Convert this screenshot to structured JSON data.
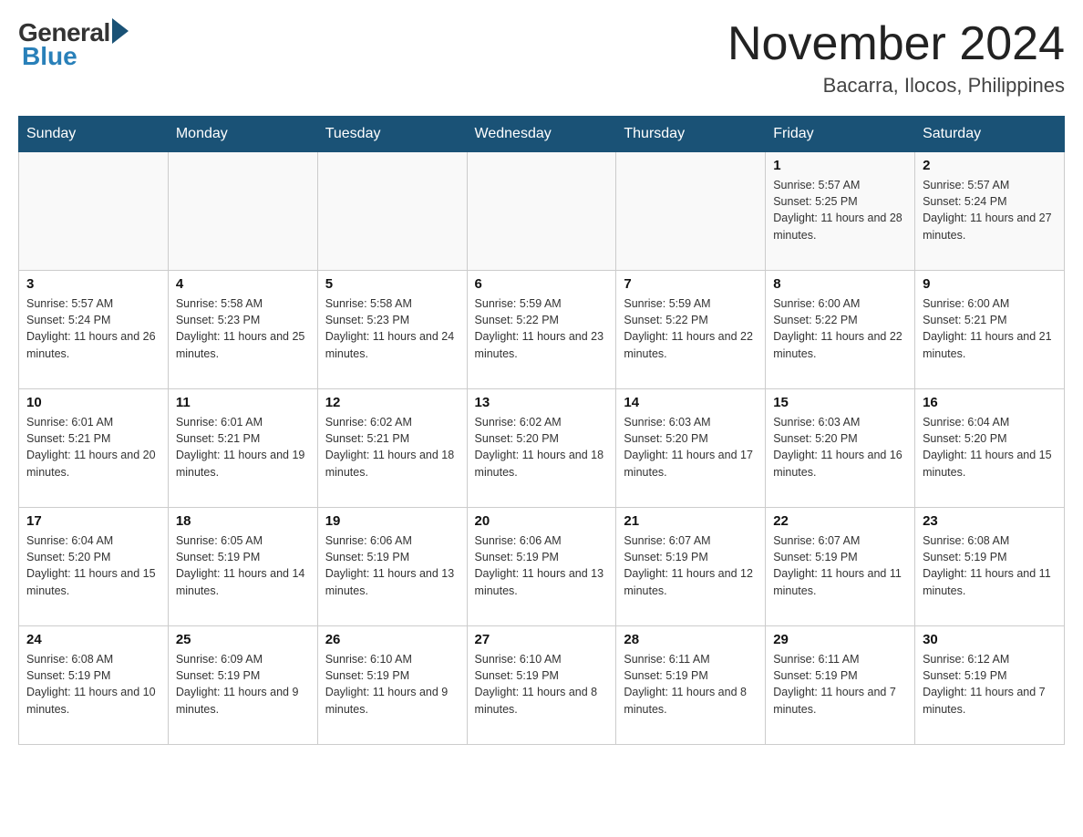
{
  "logo": {
    "general": "General",
    "blue": "Blue"
  },
  "title": "November 2024",
  "subtitle": "Bacarra, Ilocos, Philippines",
  "weekdays": [
    "Sunday",
    "Monday",
    "Tuesday",
    "Wednesday",
    "Thursday",
    "Friday",
    "Saturday"
  ],
  "weeks": [
    [
      {
        "day": "",
        "info": ""
      },
      {
        "day": "",
        "info": ""
      },
      {
        "day": "",
        "info": ""
      },
      {
        "day": "",
        "info": ""
      },
      {
        "day": "",
        "info": ""
      },
      {
        "day": "1",
        "info": "Sunrise: 5:57 AM\nSunset: 5:25 PM\nDaylight: 11 hours and 28 minutes."
      },
      {
        "day": "2",
        "info": "Sunrise: 5:57 AM\nSunset: 5:24 PM\nDaylight: 11 hours and 27 minutes."
      }
    ],
    [
      {
        "day": "3",
        "info": "Sunrise: 5:57 AM\nSunset: 5:24 PM\nDaylight: 11 hours and 26 minutes."
      },
      {
        "day": "4",
        "info": "Sunrise: 5:58 AM\nSunset: 5:23 PM\nDaylight: 11 hours and 25 minutes."
      },
      {
        "day": "5",
        "info": "Sunrise: 5:58 AM\nSunset: 5:23 PM\nDaylight: 11 hours and 24 minutes."
      },
      {
        "day": "6",
        "info": "Sunrise: 5:59 AM\nSunset: 5:22 PM\nDaylight: 11 hours and 23 minutes."
      },
      {
        "day": "7",
        "info": "Sunrise: 5:59 AM\nSunset: 5:22 PM\nDaylight: 11 hours and 22 minutes."
      },
      {
        "day": "8",
        "info": "Sunrise: 6:00 AM\nSunset: 5:22 PM\nDaylight: 11 hours and 22 minutes."
      },
      {
        "day": "9",
        "info": "Sunrise: 6:00 AM\nSunset: 5:21 PM\nDaylight: 11 hours and 21 minutes."
      }
    ],
    [
      {
        "day": "10",
        "info": "Sunrise: 6:01 AM\nSunset: 5:21 PM\nDaylight: 11 hours and 20 minutes."
      },
      {
        "day": "11",
        "info": "Sunrise: 6:01 AM\nSunset: 5:21 PM\nDaylight: 11 hours and 19 minutes."
      },
      {
        "day": "12",
        "info": "Sunrise: 6:02 AM\nSunset: 5:21 PM\nDaylight: 11 hours and 18 minutes."
      },
      {
        "day": "13",
        "info": "Sunrise: 6:02 AM\nSunset: 5:20 PM\nDaylight: 11 hours and 18 minutes."
      },
      {
        "day": "14",
        "info": "Sunrise: 6:03 AM\nSunset: 5:20 PM\nDaylight: 11 hours and 17 minutes."
      },
      {
        "day": "15",
        "info": "Sunrise: 6:03 AM\nSunset: 5:20 PM\nDaylight: 11 hours and 16 minutes."
      },
      {
        "day": "16",
        "info": "Sunrise: 6:04 AM\nSunset: 5:20 PM\nDaylight: 11 hours and 15 minutes."
      }
    ],
    [
      {
        "day": "17",
        "info": "Sunrise: 6:04 AM\nSunset: 5:20 PM\nDaylight: 11 hours and 15 minutes."
      },
      {
        "day": "18",
        "info": "Sunrise: 6:05 AM\nSunset: 5:19 PM\nDaylight: 11 hours and 14 minutes."
      },
      {
        "day": "19",
        "info": "Sunrise: 6:06 AM\nSunset: 5:19 PM\nDaylight: 11 hours and 13 minutes."
      },
      {
        "day": "20",
        "info": "Sunrise: 6:06 AM\nSunset: 5:19 PM\nDaylight: 11 hours and 13 minutes."
      },
      {
        "day": "21",
        "info": "Sunrise: 6:07 AM\nSunset: 5:19 PM\nDaylight: 11 hours and 12 minutes."
      },
      {
        "day": "22",
        "info": "Sunrise: 6:07 AM\nSunset: 5:19 PM\nDaylight: 11 hours and 11 minutes."
      },
      {
        "day": "23",
        "info": "Sunrise: 6:08 AM\nSunset: 5:19 PM\nDaylight: 11 hours and 11 minutes."
      }
    ],
    [
      {
        "day": "24",
        "info": "Sunrise: 6:08 AM\nSunset: 5:19 PM\nDaylight: 11 hours and 10 minutes."
      },
      {
        "day": "25",
        "info": "Sunrise: 6:09 AM\nSunset: 5:19 PM\nDaylight: 11 hours and 9 minutes."
      },
      {
        "day": "26",
        "info": "Sunrise: 6:10 AM\nSunset: 5:19 PM\nDaylight: 11 hours and 9 minutes."
      },
      {
        "day": "27",
        "info": "Sunrise: 6:10 AM\nSunset: 5:19 PM\nDaylight: 11 hours and 8 minutes."
      },
      {
        "day": "28",
        "info": "Sunrise: 6:11 AM\nSunset: 5:19 PM\nDaylight: 11 hours and 8 minutes."
      },
      {
        "day": "29",
        "info": "Sunrise: 6:11 AM\nSunset: 5:19 PM\nDaylight: 11 hours and 7 minutes."
      },
      {
        "day": "30",
        "info": "Sunrise: 6:12 AM\nSunset: 5:19 PM\nDaylight: 11 hours and 7 minutes."
      }
    ]
  ]
}
